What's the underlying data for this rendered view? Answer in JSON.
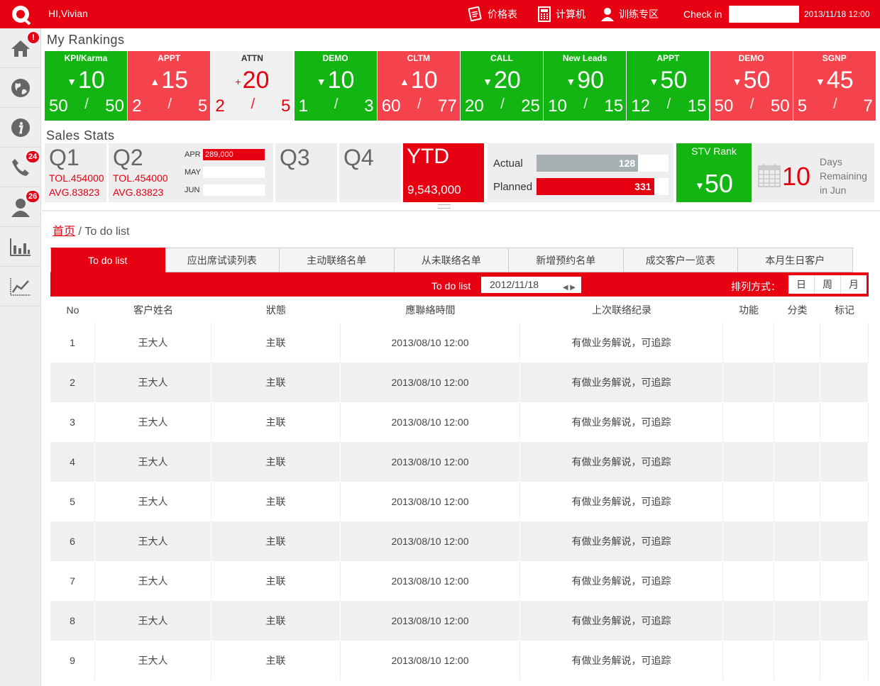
{
  "header": {
    "greeting": "HI,Vivian",
    "nav": [
      {
        "label": "价格表",
        "icon": "price-list-icon"
      },
      {
        "label": "计算机",
        "icon": "calculator-icon"
      },
      {
        "label": "训练专区",
        "icon": "user-training-icon"
      }
    ],
    "checkin_label": "Check in",
    "checkin_value": "",
    "datetime": "2013/11/18 12:00"
  },
  "sidebar": {
    "items": [
      {
        "icon": "home-icon",
        "badge": "!"
      },
      {
        "icon": "globe-icon",
        "badge": ""
      },
      {
        "icon": "info-icon",
        "badge": ""
      },
      {
        "icon": "phone-icon",
        "badge": "24"
      },
      {
        "icon": "contact-icon",
        "badge": "26"
      },
      {
        "icon": "bar-chart-icon",
        "badge": ""
      },
      {
        "icon": "line-chart-icon",
        "badge": ""
      }
    ]
  },
  "rankings": {
    "title": "My Rankings",
    "tiles": [
      {
        "label": "KPI/Karma",
        "sign": "▼",
        "value": "10",
        "a": "50",
        "b": "50",
        "color": "green"
      },
      {
        "label": "APPT",
        "sign": "▲",
        "value": "15",
        "a": "2",
        "b": "5",
        "color": "red"
      },
      {
        "label": "ATTN",
        "sign": "+",
        "value": "20",
        "a": "2",
        "b": "5",
        "color": "grey"
      },
      {
        "label": "DEMO",
        "sign": "▼",
        "value": "10",
        "a": "1",
        "b": "3",
        "color": "green"
      },
      {
        "label": "CLTM",
        "sign": "▲",
        "value": "10",
        "a": "60",
        "b": "77",
        "color": "red"
      },
      {
        "label": "CALL",
        "sign": "▼",
        "value": "20",
        "a": "20",
        "b": "25",
        "color": "green"
      },
      {
        "label": "New Leads",
        "sign": "▼",
        "value": "90",
        "a": "10",
        "b": "15",
        "color": "green"
      },
      {
        "label": "APPT",
        "sign": "▼",
        "value": "50",
        "a": "12",
        "b": "15",
        "color": "green"
      },
      {
        "label": "DEMO",
        "sign": "▼",
        "value": "50",
        "a": "50",
        "b": "50",
        "color": "red"
      },
      {
        "label": "SGNP",
        "sign": "▼",
        "value": "45",
        "a": "5",
        "b": "7",
        "color": "red"
      }
    ]
  },
  "sales": {
    "title": "Sales Stats",
    "q1": {
      "label": "Q1",
      "tol": "TOL.454000",
      "avg": "AVG.83823"
    },
    "q2": {
      "label": "Q2",
      "tol": "TOL.454000",
      "avg": "AVG.83823"
    },
    "months": [
      {
        "label": "APR",
        "value": "289,000",
        "fill": 1.0
      },
      {
        "label": "MAY",
        "value": "",
        "fill": 0
      },
      {
        "label": "JUN",
        "value": "",
        "fill": 0
      }
    ],
    "q3": "Q3",
    "q4": "Q4",
    "ytd_label": "YTD",
    "ytd_value": "9,543,000",
    "actual_label": "Actual",
    "actual_value": "128",
    "actual_fill": 0.77,
    "planned_label": "Planned",
    "planned_value": "331",
    "planned_fill": 0.89,
    "stv_label": "STV Rank",
    "stv_sign": "▼",
    "stv_value": "50",
    "days_value": "10",
    "days_text": "Days Remaining in Jun"
  },
  "breadcrumb": {
    "home": "首页",
    "sep": " / ",
    "current": "To do list"
  },
  "tabs": [
    "To do list",
    "应出席试读列表",
    "主动联络名单",
    "从未联络名单",
    "新增预约名单",
    "成交客户一览表",
    "本月生日客户"
  ],
  "toolbar": {
    "label": "To do list",
    "date": "2012/11/18",
    "arrows": "◀ ▶",
    "sort_label": "排列方式：",
    "sort_options": [
      "日",
      "周",
      "月"
    ]
  },
  "table": {
    "headers": [
      "No",
      "客户姓名",
      "狀態",
      "應聯絡時間",
      "上次联络纪录",
      "功能",
      "分类",
      "标记"
    ],
    "rows": [
      [
        "1",
        "王大人",
        "主联",
        "2013/08/10 12:00",
        "有做业务解说，可追踪",
        "",
        "",
        ""
      ],
      [
        "2",
        "王大人",
        "主联",
        "2013/08/10 12:00",
        "有做业务解说，可追踪",
        "",
        "",
        ""
      ],
      [
        "3",
        "王大人",
        "主联",
        "2013/08/10 12:00",
        "有做业务解说，可追踪",
        "",
        "",
        ""
      ],
      [
        "4",
        "王大人",
        "主联",
        "2013/08/10 12:00",
        "有做业务解说，可追踪",
        "",
        "",
        ""
      ],
      [
        "5",
        "王大人",
        "主联",
        "2013/08/10 12:00",
        "有做业务解说，可追踪",
        "",
        "",
        ""
      ],
      [
        "6",
        "王大人",
        "主联",
        "2013/08/10 12:00",
        "有做业务解说，可追踪",
        "",
        "",
        ""
      ],
      [
        "7",
        "王大人",
        "主联",
        "2013/08/10 12:00",
        "有做业务解说，可追踪",
        "",
        "",
        ""
      ],
      [
        "8",
        "王大人",
        "主联",
        "2013/08/10 12:00",
        "有做业务解说，可追踪",
        "",
        "",
        ""
      ],
      [
        "9",
        "王大人",
        "主联",
        "2013/08/10 12:00",
        "有做业务解说，可追踪",
        "",
        "",
        ""
      ]
    ]
  },
  "colors": {
    "brand": "#e60012",
    "green": "#13b513",
    "red_tile": "#f5434d"
  }
}
